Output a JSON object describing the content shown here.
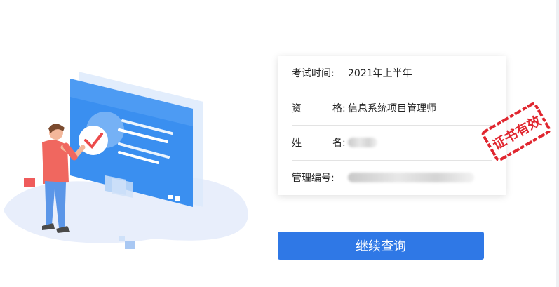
{
  "card": {
    "exam_time": {
      "label": "考试时间",
      "colon": ":",
      "value": "2021年上半年"
    },
    "qualification": {
      "label_chars": [
        "资",
        "格"
      ],
      "colon": ":",
      "value": "信息系统项目管理师"
    },
    "name": {
      "label_chars": [
        "姓",
        "名"
      ],
      "colon": ":"
    },
    "cert_number": {
      "label": "管理编号",
      "colon": ":"
    }
  },
  "stamp": {
    "text": "证书有效",
    "color": "#e0262f"
  },
  "query_button": {
    "label": "继续查询",
    "color": "#2f78e6"
  },
  "illustration": {
    "icon": "certificate-check-illustration",
    "accent": "#3d8cf0"
  }
}
